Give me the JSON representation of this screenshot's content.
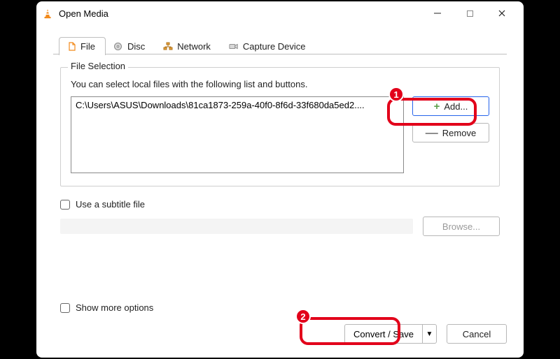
{
  "window": {
    "title": "Open Media"
  },
  "tabs": {
    "file": "File",
    "disc": "Disc",
    "network": "Network",
    "capture": "Capture Device"
  },
  "fileSelection": {
    "legend": "File Selection",
    "hint": "You can select local files with the following list and buttons.",
    "files": [
      "C:\\Users\\ASUS\\Downloads\\81ca1873-259a-40f0-8f6d-33f680da5ed2...."
    ],
    "addLabel": "Add...",
    "removeLabel": "Remove"
  },
  "subtitle": {
    "checkboxLabel": "Use a subtitle file",
    "browseLabel": "Browse..."
  },
  "bottom": {
    "moreOptionsLabel": "Show more options",
    "convertSaveLabel": "Convert / Save",
    "cancelLabel": "Cancel"
  },
  "annotations": {
    "step1": "1",
    "step2": "2"
  }
}
